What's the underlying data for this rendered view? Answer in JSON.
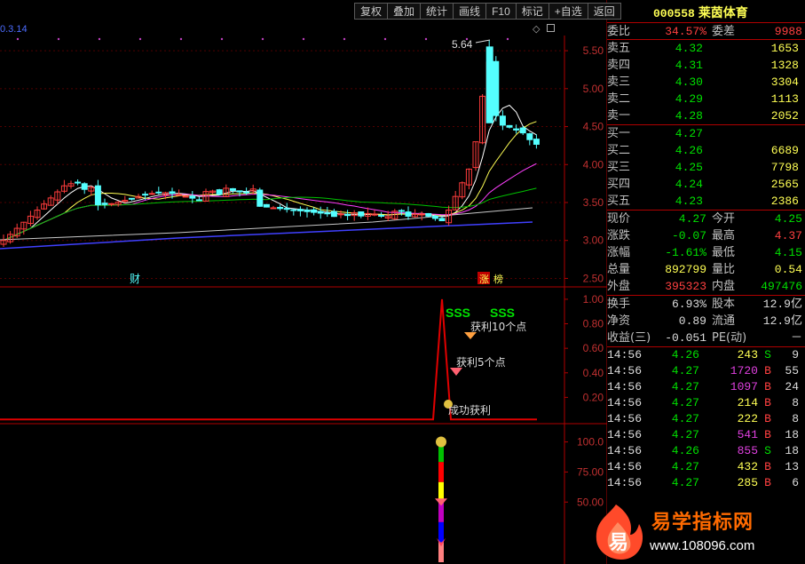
{
  "toolbar": {
    "buttons": [
      "复权",
      "叠加",
      "统计",
      "画线",
      "F10",
      "标记",
      "+自选",
      "返回"
    ],
    "icons": [
      "diamond-icon",
      "square-icon"
    ]
  },
  "main_chart": {
    "tag_left": "0.3.14",
    "peak_label": "5.64",
    "marker_cai": "财",
    "marker_zhang": "涨",
    "marker_bang": "榜"
  },
  "signal_panel": {
    "sss_1": "SSS",
    "sss_2": "SSS",
    "profit_10": "获利10个点",
    "profit_5": "获利5个点",
    "success": "成功获利"
  },
  "chart_data": [
    {
      "type": "candlestick",
      "ylim": [
        2.4,
        5.7
      ],
      "y_ticks": [
        "5.50",
        "5.00",
        "4.50",
        "4.00",
        "3.50",
        "3.00",
        "2.50"
      ],
      "moving_average_colors": [
        "#ffffff",
        "#ffff54",
        "#ff40ff",
        "#00c000",
        "#c8c8c8",
        "#4040ff"
      ]
    },
    {
      "type": "line",
      "ylim": [
        0,
        1.05
      ],
      "y_ticks": [
        "1.00",
        "0.80",
        "0.60",
        "0.40",
        "0.20"
      ]
    },
    {
      "type": "bar",
      "ylim": [
        0,
        110
      ],
      "y_ticks": [
        "100.0",
        "75.00",
        "50.00"
      ]
    }
  ],
  "quote": {
    "code": "000558",
    "name": "莱茵体育",
    "weibi_label": "委比",
    "weibi": "34.57%",
    "weicha_label": "委差",
    "weicha": "9988",
    "asks": [
      {
        "label": "卖五",
        "price": "4.32",
        "vol": "1653"
      },
      {
        "label": "卖四",
        "price": "4.31",
        "vol": "1328"
      },
      {
        "label": "卖三",
        "price": "4.30",
        "vol": "3304"
      },
      {
        "label": "卖二",
        "price": "4.29",
        "vol": "1113"
      },
      {
        "label": "卖一",
        "price": "4.28",
        "vol": "2052"
      }
    ],
    "bids": [
      {
        "label": "买一",
        "price": "4.27",
        "vol": ""
      },
      {
        "label": "买二",
        "price": "4.26",
        "vol": "6689"
      },
      {
        "label": "买三",
        "price": "4.25",
        "vol": "7798"
      },
      {
        "label": "买四",
        "price": "4.24",
        "vol": "2565"
      },
      {
        "label": "买五",
        "price": "4.23",
        "vol": "2386"
      }
    ],
    "stats1": [
      {
        "l1": "现价",
        "v1": "4.27",
        "c1": "green",
        "l2": "今开",
        "v2": "4.25",
        "c2": "green"
      },
      {
        "l1": "涨跌",
        "v1": "-0.07",
        "c1": "green",
        "l2": "最高",
        "v2": "4.37",
        "c2": "red"
      },
      {
        "l1": "涨幅",
        "v1": "-1.61%",
        "c1": "green",
        "l2": "最低",
        "v2": "4.15",
        "c2": "green"
      },
      {
        "l1": "总量",
        "v1": "892799",
        "c1": "yellow",
        "l2": "量比",
        "v2": "0.54",
        "c2": "yellow"
      },
      {
        "l1": "外盘",
        "v1": "395323",
        "c1": "red",
        "l2": "内盘",
        "v2": "497476",
        "c2": "green"
      }
    ],
    "stats2": [
      {
        "l1": "换手",
        "v1": "6.93%",
        "l2": "股本",
        "v2": "12.9亿"
      },
      {
        "l1": "净资",
        "v1": "0.89",
        "l2": "流通",
        "v2": "12.9亿"
      },
      {
        "l1": "收益(三)",
        "v1": "-0.051",
        "l2": "PE(动)",
        "v2": "－"
      }
    ],
    "ticks": [
      {
        "time": "14:56",
        "price": "4.26",
        "pc": "green",
        "vol": "243",
        "vc": "yellow",
        "side": "S",
        "sc": "green",
        "n": "9"
      },
      {
        "time": "14:56",
        "price": "4.27",
        "pc": "green",
        "vol": "1720",
        "vc": "magenta",
        "side": "B",
        "sc": "red",
        "n": "55"
      },
      {
        "time": "14:56",
        "price": "4.27",
        "pc": "green",
        "vol": "1097",
        "vc": "magenta",
        "side": "B",
        "sc": "red",
        "n": "24"
      },
      {
        "time": "14:56",
        "price": "4.27",
        "pc": "green",
        "vol": "214",
        "vc": "yellow",
        "side": "B",
        "sc": "red",
        "n": "8"
      },
      {
        "time": "14:56",
        "price": "4.27",
        "pc": "green",
        "vol": "222",
        "vc": "yellow",
        "side": "B",
        "sc": "red",
        "n": "8"
      },
      {
        "time": "14:56",
        "price": "4.27",
        "pc": "green",
        "vol": "541",
        "vc": "magenta",
        "side": "B",
        "sc": "red",
        "n": "18"
      },
      {
        "time": "14:56",
        "price": "4.26",
        "pc": "green",
        "vol": "855",
        "vc": "magenta",
        "side": "S",
        "sc": "green",
        "n": "18"
      },
      {
        "time": "14:56",
        "price": "4.27",
        "pc": "green",
        "vol": "432",
        "vc": "yellow",
        "side": "B",
        "sc": "red",
        "n": "13"
      },
      {
        "time": "14:56",
        "price": "4.27",
        "pc": "green",
        "vol": "285",
        "vc": "yellow",
        "side": "B",
        "sc": "red",
        "n": "6"
      }
    ]
  },
  "watermark": {
    "glyph": "易",
    "title": "易学指标网",
    "url": "www.108096.com"
  }
}
